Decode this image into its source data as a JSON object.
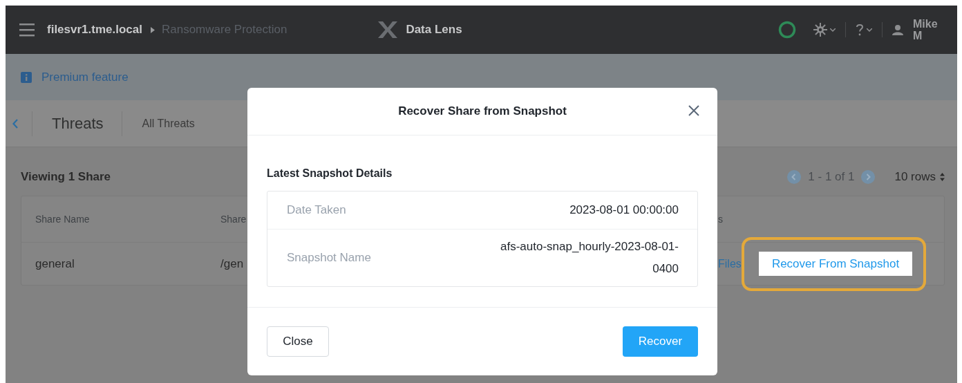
{
  "header": {
    "breadcrumb": [
      "filesvr1.tme.local",
      "Ransomware Protection"
    ],
    "app_name": "Data Lens",
    "user_name": "Mike M"
  },
  "banner": {
    "text": "Premium feature"
  },
  "nav": {
    "title": "Threats",
    "links": [
      "All Threats"
    ]
  },
  "content": {
    "heading": "Viewing 1 Share",
    "pagination": "1 - 1 of 1",
    "rows_per_page": "10 rows"
  },
  "table": {
    "columns": [
      "Share Name",
      "Share",
      "s"
    ],
    "rows": [
      {
        "cells": [
          "general",
          "/gen",
          "Files"
        ],
        "action": "Recover From Snapshot",
        "highlighted": true
      }
    ]
  },
  "dialog": {
    "title": "Recover Share from Snapshot",
    "section_title": "Latest Snapshot Details",
    "details": [
      {
        "label": "Date Taken",
        "value": "2023-08-01 00:00:00"
      },
      {
        "label": "Snapshot Name",
        "value": "afs-auto-snap_hourly-2023-08-01-0400"
      }
    ],
    "buttons": [
      {
        "kind": "secondary",
        "label": "Close"
      },
      {
        "kind": "primary",
        "label": "Recover"
      }
    ]
  }
}
